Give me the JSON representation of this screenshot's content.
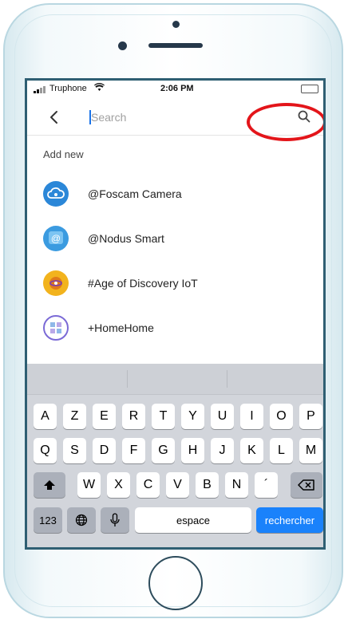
{
  "status_bar": {
    "carrier": "Truphone",
    "time": "2:06 PM"
  },
  "search": {
    "placeholder": "Search"
  },
  "section_label": "Add new",
  "items": [
    {
      "label": "@Foscam Camera",
      "icon": "cloud-camera-icon",
      "color": "#2b87d8"
    },
    {
      "label": "@Nodus Smart",
      "icon": "nodus-at-icon",
      "color": "#3b9be0"
    },
    {
      "label": "#Age of Discovery IoT",
      "icon": "discovery-icon",
      "color": "#f2b31d"
    },
    {
      "label": "+HomeHome",
      "icon": "home-grid-icon",
      "color": "#7b6ad6"
    }
  ],
  "keyboard": {
    "row1": [
      "A",
      "Z",
      "E",
      "R",
      "T",
      "Y",
      "U",
      "I",
      "O",
      "P"
    ],
    "row2": [
      "Q",
      "S",
      "D",
      "F",
      "G",
      "H",
      "J",
      "K",
      "L",
      "M"
    ],
    "row3": [
      "W",
      "X",
      "C",
      "V",
      "B",
      "N",
      "´"
    ],
    "numbers_key": "123",
    "space_key": "espace",
    "action_key": "rechercher"
  },
  "colors": {
    "highlight": "#e3151a",
    "action_key": "#1a82fb",
    "phone_trim": "#b9d7e1"
  }
}
